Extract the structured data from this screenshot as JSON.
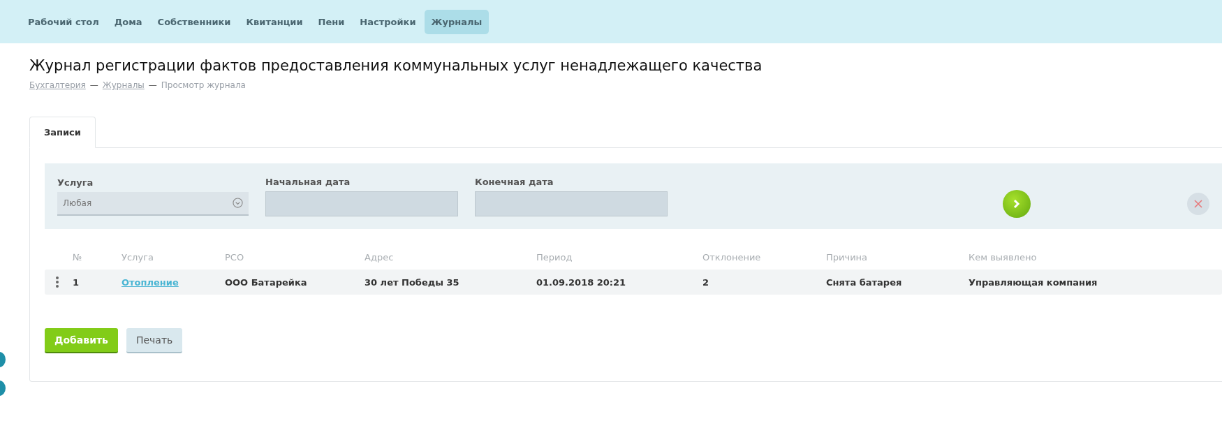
{
  "nav": [
    {
      "label": "Рабочий стол",
      "selected": false
    },
    {
      "label": "Дома",
      "selected": false
    },
    {
      "label": "Собственники",
      "selected": false
    },
    {
      "label": "Квитанции",
      "selected": false
    },
    {
      "label": "Пени",
      "selected": false
    },
    {
      "label": "Настройки",
      "selected": false
    },
    {
      "label": "Журналы",
      "selected": true
    }
  ],
  "title": "Журнал регистрации фактов предоставления коммунальных услуг ненадлежащего качества",
  "breadcrumbs": [
    {
      "label": "Бухгалтерия",
      "kind": "link"
    },
    {
      "label": "Журналы",
      "kind": "link"
    },
    {
      "label": "Просмотр журнала",
      "kind": "current"
    }
  ],
  "breadcrumb_separator": "—",
  "tabs": [
    {
      "label": "Записи",
      "selected": true
    }
  ],
  "filters": [
    {
      "label": "Услуга",
      "kind": "select",
      "value": "Любая"
    },
    {
      "label": "Начальная дата",
      "kind": "date"
    },
    {
      "label": "Конечная дата",
      "kind": "date"
    }
  ],
  "table": {
    "columns": [
      "№",
      "Услуга",
      "РСО",
      "Адрес",
      "Период",
      "Отклонение",
      "Причина",
      "Кем выявлено"
    ],
    "rows": [
      [
        "1",
        "Отопление",
        "ООО Батарейка",
        "30 лет Победы 35",
        "01.09.2018 20:21",
        "2",
        "Снята батарея",
        "Управляющая компания"
      ]
    ]
  },
  "buttons": [
    {
      "label": "Добавить",
      "kind": "primary"
    },
    {
      "label": "Печать",
      "kind": "secondary"
    }
  ]
}
